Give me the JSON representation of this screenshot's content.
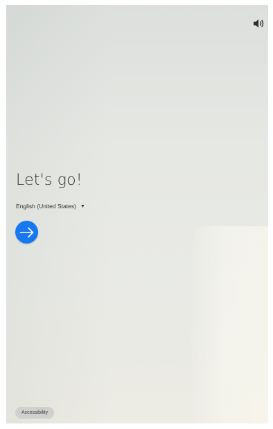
{
  "welcome": {
    "title": "Let's go!",
    "language": {
      "selected": "English (United States)"
    },
    "next_icon": "arrow-right-icon",
    "accent_color": "#1878f0"
  },
  "top_bar": {
    "volume_icon": "volume-icon"
  },
  "footer": {
    "accessibility_label": "Accessibility"
  }
}
